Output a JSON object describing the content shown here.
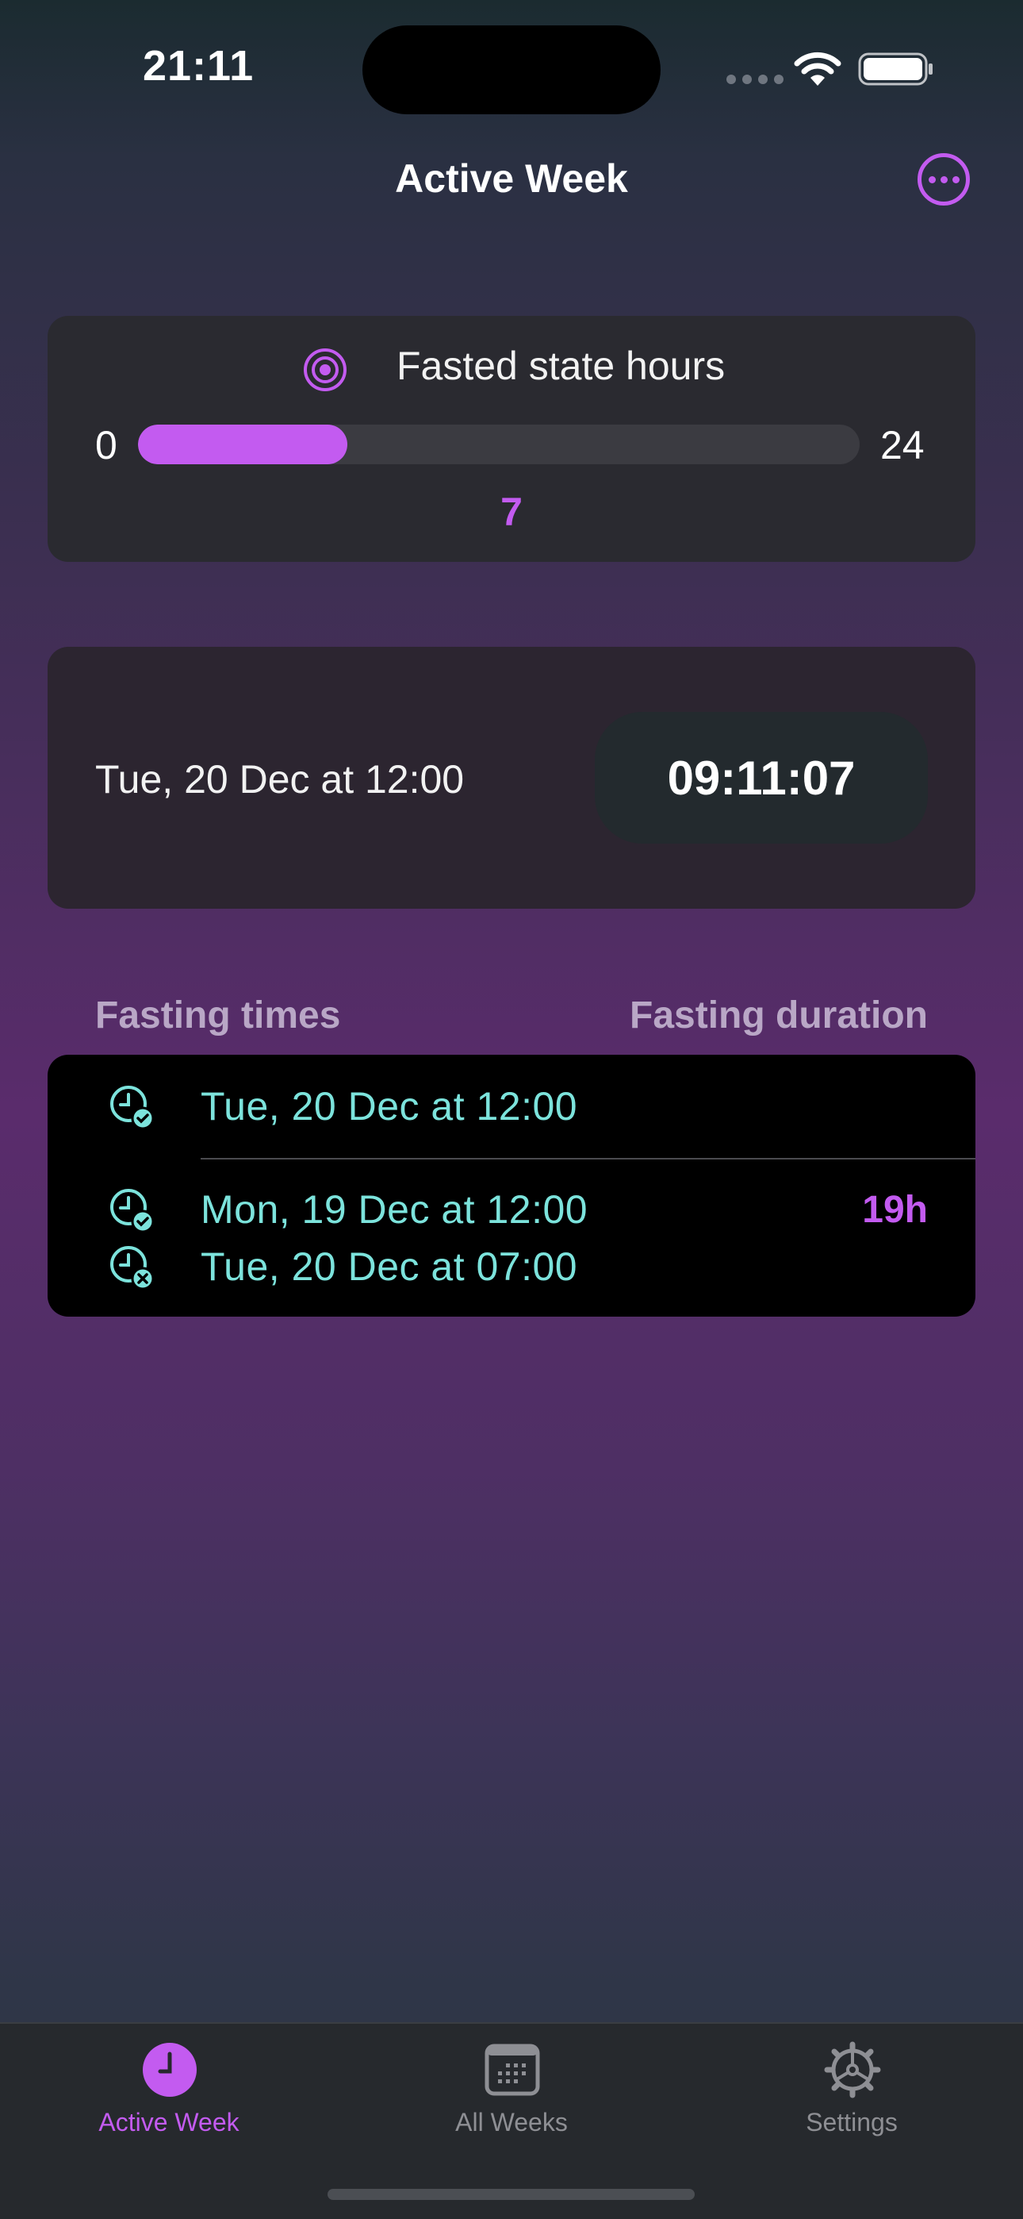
{
  "status_bar": {
    "time": "21:11"
  },
  "nav": {
    "title": "Active Week"
  },
  "goal": {
    "label": "Fasted state hours",
    "min": "0",
    "max": "24",
    "value": "7",
    "progress_fraction": 0.29
  },
  "timer": {
    "start": "Tue, 20 Dec at 12:00",
    "elapsed": "09:11:07"
  },
  "list": {
    "header_left": "Fasting times",
    "header_right": "Fasting duration",
    "rows": [
      {
        "start": "Tue, 20 Dec at 12:00",
        "end": "",
        "duration": ""
      },
      {
        "start": "Mon, 19 Dec at 12:00",
        "end": "Tue, 20 Dec at 07:00",
        "duration": "19h"
      }
    ]
  },
  "tabs": [
    {
      "label": "Active Week",
      "icon": "clock-icon",
      "active": true
    },
    {
      "label": "All Weeks",
      "icon": "calendar-icon",
      "active": false
    },
    {
      "label": "Settings",
      "icon": "gear-icon",
      "active": false
    }
  ],
  "colors": {
    "accent": "#c35bf0",
    "teal": "#7ce3dc",
    "inactive_tab": "#8e8f94"
  }
}
